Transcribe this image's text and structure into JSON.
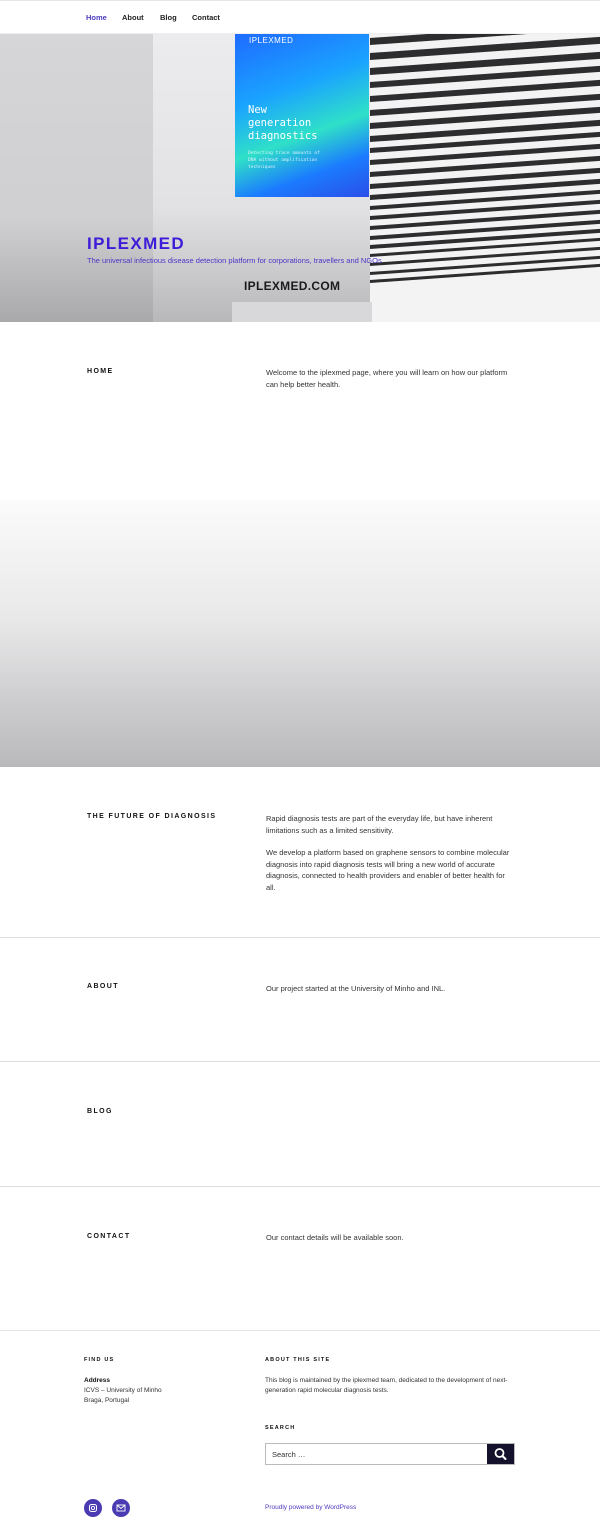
{
  "nav": {
    "items": [
      {
        "label": "Home",
        "active": true
      },
      {
        "label": "About",
        "active": false
      },
      {
        "label": "Blog",
        "active": false
      },
      {
        "label": "Contact",
        "active": false
      }
    ]
  },
  "hero": {
    "banner_brand": "IPLEXMED",
    "banner_headline": "New\ngeneration\ndiagnostics",
    "banner_sub": "Detecting trace amounts of\nDNA without amplification\ntechniques",
    "wall_print": "IPLEXMED.COM",
    "site_title": "IPLEXMED",
    "tagline": "The universal infectious disease detection platform for corporations, travellers and NGOs"
  },
  "sections": {
    "home": {
      "label": "HOME",
      "paragraphs": [
        "Welcome to the iplexmed page, where you will learn on how our platform can help better health."
      ]
    },
    "future": {
      "label": "THE FUTURE OF DIAGNOSIS",
      "paragraphs": [
        "Rapid diagnosis tests are part of the everyday life, but have inherent limitations such as a limited sensitivity.",
        "We develop a platform based on graphene sensors to combine molecular diagnosis into rapid diagnosis tests will bring a new world of accurate diagnosis, connected to health providers and enabler of better health for all."
      ]
    },
    "about": {
      "label": "ABOUT",
      "paragraphs": [
        "Our project started at the University of Minho and INL."
      ]
    },
    "blog": {
      "label": "BLOG"
    },
    "contact": {
      "label": "CONTACT",
      "paragraphs": [
        "Our contact details will be available soon."
      ]
    }
  },
  "footer": {
    "find_us": {
      "heading": "FIND US",
      "address_label": "Address",
      "address_line1": "ICVS – University of Minho",
      "address_line2": "Braga, Portugal"
    },
    "about_site": {
      "heading": "ABOUT THIS SITE",
      "text": "This blog is maintained by the iplexmed team, dedicated to the development of next-generation rapid molecular diagnosis tests."
    },
    "search": {
      "heading": "SEARCH",
      "placeholder": "Search …"
    },
    "social": [
      {
        "icon": "instagram-icon"
      },
      {
        "icon": "mail-icon"
      }
    ],
    "powered_by": "Proudly powered by WordPress"
  },
  "colors": {
    "accent": "#4c3bbf",
    "title": "#3d1bd8",
    "search_button": "#13112b"
  }
}
